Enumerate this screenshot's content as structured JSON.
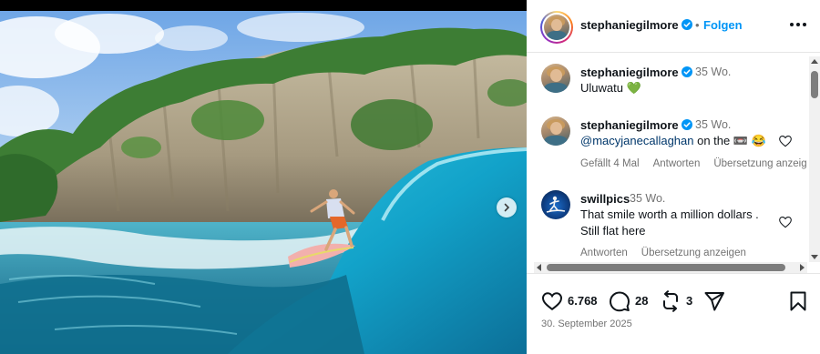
{
  "post": {
    "username": "stephaniegilmore",
    "follow_label": "Folgen",
    "separator": "•"
  },
  "media": {
    "next_icon": "chevron-right-icon"
  },
  "comments": [
    {
      "username": "stephaniegilmore",
      "time": "35 Wo.",
      "text": "Uluwatu",
      "emoji": "💚"
    },
    {
      "username": "stephaniegilmore",
      "time": "35 Wo.",
      "mention": "@macyjanecallaghan",
      "text": " on the ",
      "emoji": "📼 😂",
      "likes": "Gefällt 4 Mal",
      "reply": "Antworten",
      "translate": "Übersetzung anzeig"
    },
    {
      "username": "swillpics",
      "time": "35 Wo.",
      "line1": "That smile worth a million dollars .",
      "line2": "Still flat here",
      "reply": "Antworten",
      "translate": "Übersetzung anzeigen"
    }
  ],
  "actions": {
    "likes": "6.768",
    "comments": "28",
    "reposts": "3",
    "date": "30. September 2025"
  },
  "colors": {
    "follow": "#0095f6",
    "verified": "#0095f6",
    "muted": "#737373",
    "mention": "#00376b"
  }
}
